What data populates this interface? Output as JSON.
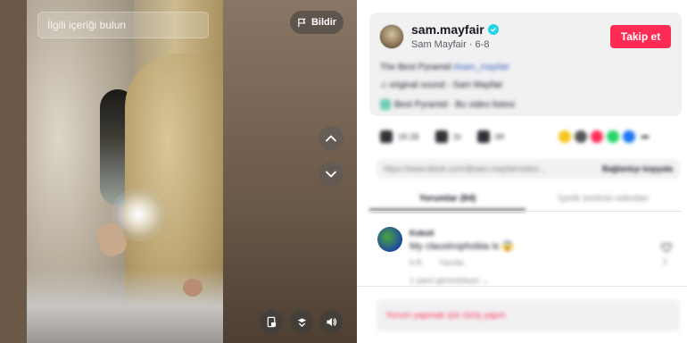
{
  "search": {
    "placeholder": "İlgili içeriği bulun",
    "icon": "search-icon"
  },
  "video": {
    "report_label": "Bildir",
    "controls": [
      "prev-video-icon",
      "next-video-icon",
      "miniplayer-icon",
      "pip-icon",
      "volume-icon"
    ]
  },
  "author": {
    "username": "sam.mayfair",
    "verified": true,
    "display_name": "Sam Mayfair",
    "date": "6-8",
    "follow_label": "Takip et"
  },
  "post": {
    "title": "The Best Pyramid",
    "hashtag": "#sam_mayfair",
    "sound": "♫ original sound - Sam Mayfair",
    "playlist": "Best Pyramid · Bu video listesi",
    "likes": "18.1B",
    "comments": "1k",
    "saves": "6K",
    "link": "https://www.tiktok.com/@sam.mayfair/video...",
    "copy_link_label": "Bağlantıyı kopyala"
  },
  "share_colors": [
    "#f5c518",
    "#555555",
    "#fe2c55",
    "#25d366",
    "#1877f2"
  ],
  "tabs": [
    {
      "label": "Yorumlar (84)",
      "active": true
    },
    {
      "label": "İçerik üreticisi videoları",
      "active": false
    }
  ],
  "comment": {
    "user": "Kokoli",
    "text": "My claustrophobia is",
    "emoji": "😱",
    "age": "6-8",
    "reply_label": "Yanıtla",
    "likes": "1",
    "more_replies": "1 yanıt görüntüleyin"
  },
  "login_prompt": "Yorum yapmak için Giriş yapın"
}
